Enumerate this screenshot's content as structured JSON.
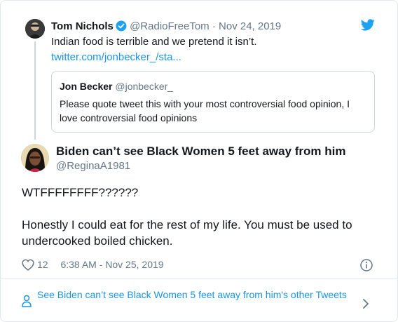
{
  "parent_tweet": {
    "name": "Tom Nichols",
    "handle": "@RadioFreeTom",
    "separator": "·",
    "date": "Nov 24, 2019",
    "text": "Indian food is terrible and we pretend it isn’t.",
    "link": "twitter.com/jonbecker_/sta..."
  },
  "quoted_tweet": {
    "name": "Jon Becker",
    "handle": "@jonbecker_",
    "text": "Please quote tweet this with your most controversial food opinion, I love controversial food opinions"
  },
  "main_tweet": {
    "name": "Biden can’t see Black Women 5 feet away from him",
    "handle": "@ReginaA1981",
    "line1": "WTFFFFFFFF??????",
    "line2": "Honestly I could eat for the rest of my life.  You must be used to undercooked boiled chicken.",
    "likes": "12",
    "timestamp": "6:38 AM - Nov 25, 2019"
  },
  "more_link": "See Biden can’t see Black Women 5 feet away from him's other Tweets",
  "icons": {
    "brand": "twitter-bird-icon",
    "verified": "verified-badge-icon",
    "like": "heart-icon",
    "info": "info-icon",
    "profile": "person-icon",
    "chevron": "chevron-right-icon"
  },
  "colors": {
    "link_blue": "#1b95e0",
    "muted": "#657786",
    "border": "#e1e8ed"
  }
}
